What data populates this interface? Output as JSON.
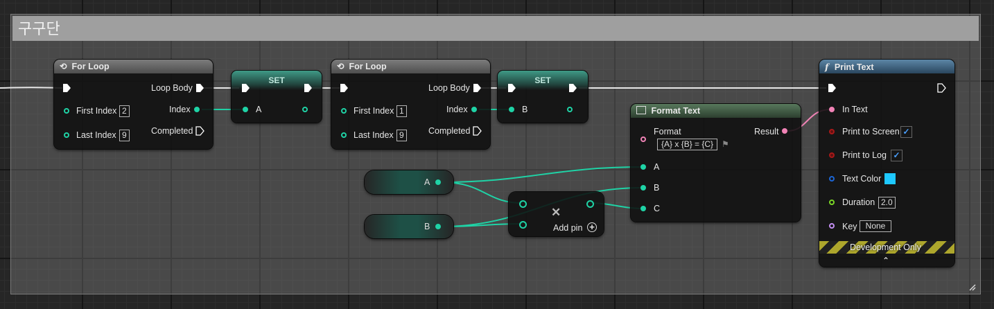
{
  "comment": {
    "title": "구구단"
  },
  "for_loop_1": {
    "title": "For Loop",
    "first_index_label": "First Index",
    "first_index_value": "2",
    "last_index_label": "Last Index",
    "last_index_value": "9",
    "loop_body_label": "Loop Body",
    "index_label": "Index",
    "completed_label": "Completed"
  },
  "set_1": {
    "title": "SET",
    "var_label": "A"
  },
  "for_loop_2": {
    "title": "For Loop",
    "first_index_label": "First Index",
    "first_index_value": "1",
    "last_index_label": "Last Index",
    "last_index_value": "9",
    "loop_body_label": "Loop Body",
    "index_label": "Index",
    "completed_label": "Completed"
  },
  "set_2": {
    "title": "SET",
    "var_label": "B"
  },
  "format_text": {
    "title": "Format Text",
    "format_label": "Format",
    "format_value": "{A} x {B} = {C}",
    "result_label": "Result",
    "pin_a": "A",
    "pin_b": "B",
    "pin_c": "C"
  },
  "get_a": {
    "label": "A"
  },
  "get_b": {
    "label": "B"
  },
  "make_array": {
    "add_pin_label": "Add pin"
  },
  "print_text": {
    "title": "Print Text",
    "in_text_label": "In Text",
    "print_to_screen_label": "Print to Screen",
    "print_to_screen_checked": true,
    "print_to_log_label": "Print to Log",
    "print_to_log_checked": true,
    "text_color_label": "Text Color",
    "text_color_value": "#1ec8ff",
    "duration_label": "Duration",
    "duration_value": "2.0",
    "key_label": "Key",
    "key_value": "None",
    "dev_only_label": "Development Only"
  },
  "colors": {
    "exec": "#ffffff",
    "integer": "#1fd3a6",
    "text": "#f183b6"
  }
}
